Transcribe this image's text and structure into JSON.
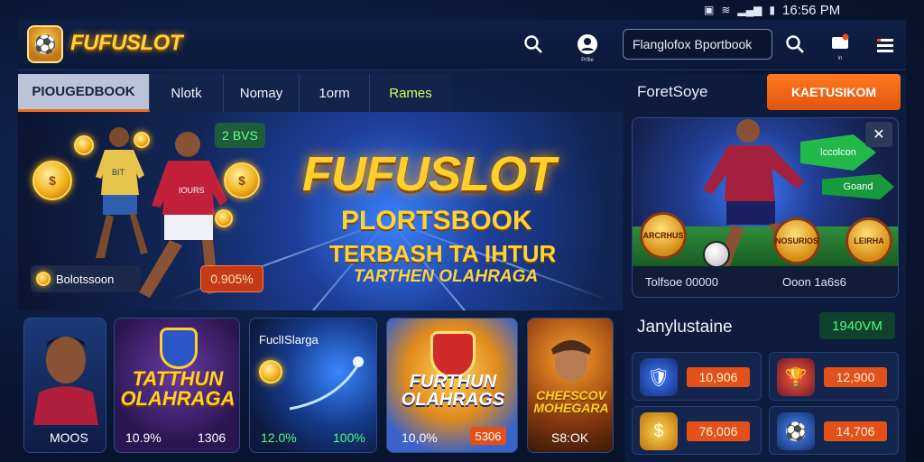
{
  "status_bar": {
    "time": "16:56 PM"
  },
  "header": {
    "logo_text": "FUFUSLOT",
    "user_icon_label": "Prfile",
    "search_text": "Flanglofox Bportbook",
    "mail_icon_label": "ln"
  },
  "tabs": [
    {
      "label": "PIOUGEDBOOK",
      "active": true
    },
    {
      "label": "Nlotk"
    },
    {
      "label": "Nomay"
    },
    {
      "label": "1orm"
    },
    {
      "label": "Rames"
    }
  ],
  "hero": {
    "chip_text": "2 BVS",
    "title": "FUFUSLOT",
    "sub1": "PLORTSBOOK",
    "sub2": "TERBASH TA IHTUR",
    "sub3": "TARTHEN OLAHRAGA",
    "balance_label": "Bolotssoon",
    "odd_value": "0.905%",
    "player1_number": "BIT",
    "player2_number": "IOURS"
  },
  "cards": [
    {
      "label": "MOOS"
    },
    {
      "title": "TATTHUN\nOLAHRAGA",
      "left": "10.9%",
      "right": "1306"
    },
    {
      "title": "FuclISlarga",
      "left": "12.0%",
      "right": "100%"
    },
    {
      "title": "FURTHUN\nOLAHRAGS",
      "left": "10,0%",
      "right": "5306"
    },
    {
      "title": "CHEFSCOV\nMOHEGARA",
      "label": "S8:OK"
    }
  ],
  "right_panel": {
    "title": "ForetSoye",
    "cta": "KAETUSIKOM",
    "sign_text": "lccolcon",
    "sign_sub": "Goand",
    "feature_left": "Tolfsoe 00000",
    "feature_right": "Ooon 1a6s6",
    "badge_left": "ARCRHUS",
    "badge_mid": "NOSURIOS",
    "badge_right": "LEIRHA"
  },
  "jackpot": {
    "title": "Janylustaine",
    "value": "1940VM",
    "items": [
      {
        "icon": "shield-icon",
        "odd": "10,906"
      },
      {
        "icon": "trophy-icon",
        "odd": "12,900"
      },
      {
        "icon": "coin-icon",
        "odd": "76,006"
      },
      {
        "icon": "badge-icon",
        "odd": "14,706"
      }
    ]
  }
}
